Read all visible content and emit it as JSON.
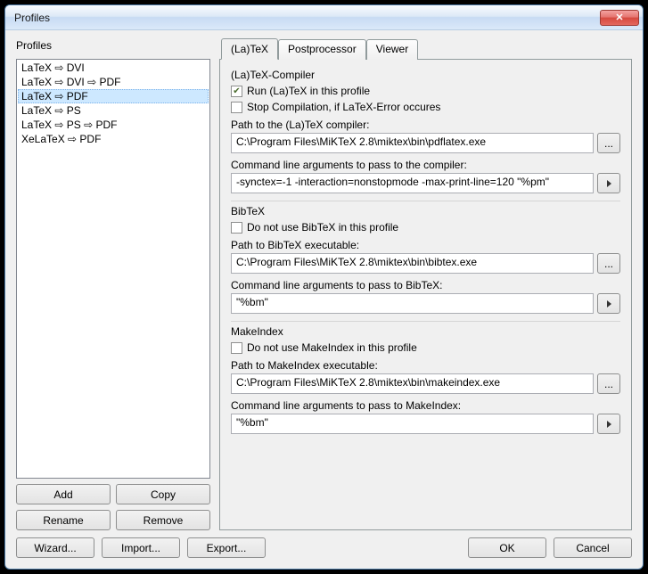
{
  "window": {
    "title": "Profiles"
  },
  "left": {
    "label": "Profiles",
    "items": [
      "LaTeX ⇨ DVI",
      "LaTeX ⇨ DVI ⇨ PDF",
      "LaTeX ⇨ PDF",
      "LaTeX ⇨ PS",
      "LaTeX ⇨ PS ⇨ PDF",
      "XeLaTeX ⇨ PDF"
    ],
    "selected_index": 2,
    "buttons": {
      "add": "Add",
      "copy": "Copy",
      "rename": "Rename",
      "remove": "Remove"
    }
  },
  "tabs": {
    "latex": "(La)TeX",
    "post": "Postprocessor",
    "viewer": "Viewer",
    "active": "latex"
  },
  "latex": {
    "section": "(La)TeX-Compiler",
    "run_checked": true,
    "run_label": "Run (La)TeX in this profile",
    "stop_checked": false,
    "stop_label": "Stop Compilation, if LaTeX-Error occures",
    "path_label": "Path to the (La)TeX compiler:",
    "path_value": "C:\\Program Files\\MiKTeX 2.8\\miktex\\bin\\pdflatex.exe",
    "args_label": "Command line arguments to pass to the compiler:",
    "args_value": "-synctex=-1 -interaction=nonstopmode -max-print-line=120 \"%pm\""
  },
  "bibtex": {
    "section": "BibTeX",
    "skip_checked": false,
    "skip_label": "Do not use BibTeX in this profile",
    "path_label": "Path to BibTeX executable:",
    "path_value": "C:\\Program Files\\MiKTeX 2.8\\miktex\\bin\\bibtex.exe",
    "args_label": "Command line arguments to pass to BibTeX:",
    "args_value": "\"%bm\""
  },
  "makeindex": {
    "section": "MakeIndex",
    "skip_checked": false,
    "skip_label": "Do not use MakeIndex in this profile",
    "path_label": "Path to MakeIndex executable:",
    "path_value": "C:\\Program Files\\MiKTeX 2.8\\miktex\\bin\\makeindex.exe",
    "args_label": "Command line arguments to pass to MakeIndex:",
    "args_value": "\"%bm\""
  },
  "bottom": {
    "wizard": "Wizard...",
    "import": "Import...",
    "export": "Export...",
    "ok": "OK",
    "cancel": "Cancel"
  },
  "browse": "..."
}
